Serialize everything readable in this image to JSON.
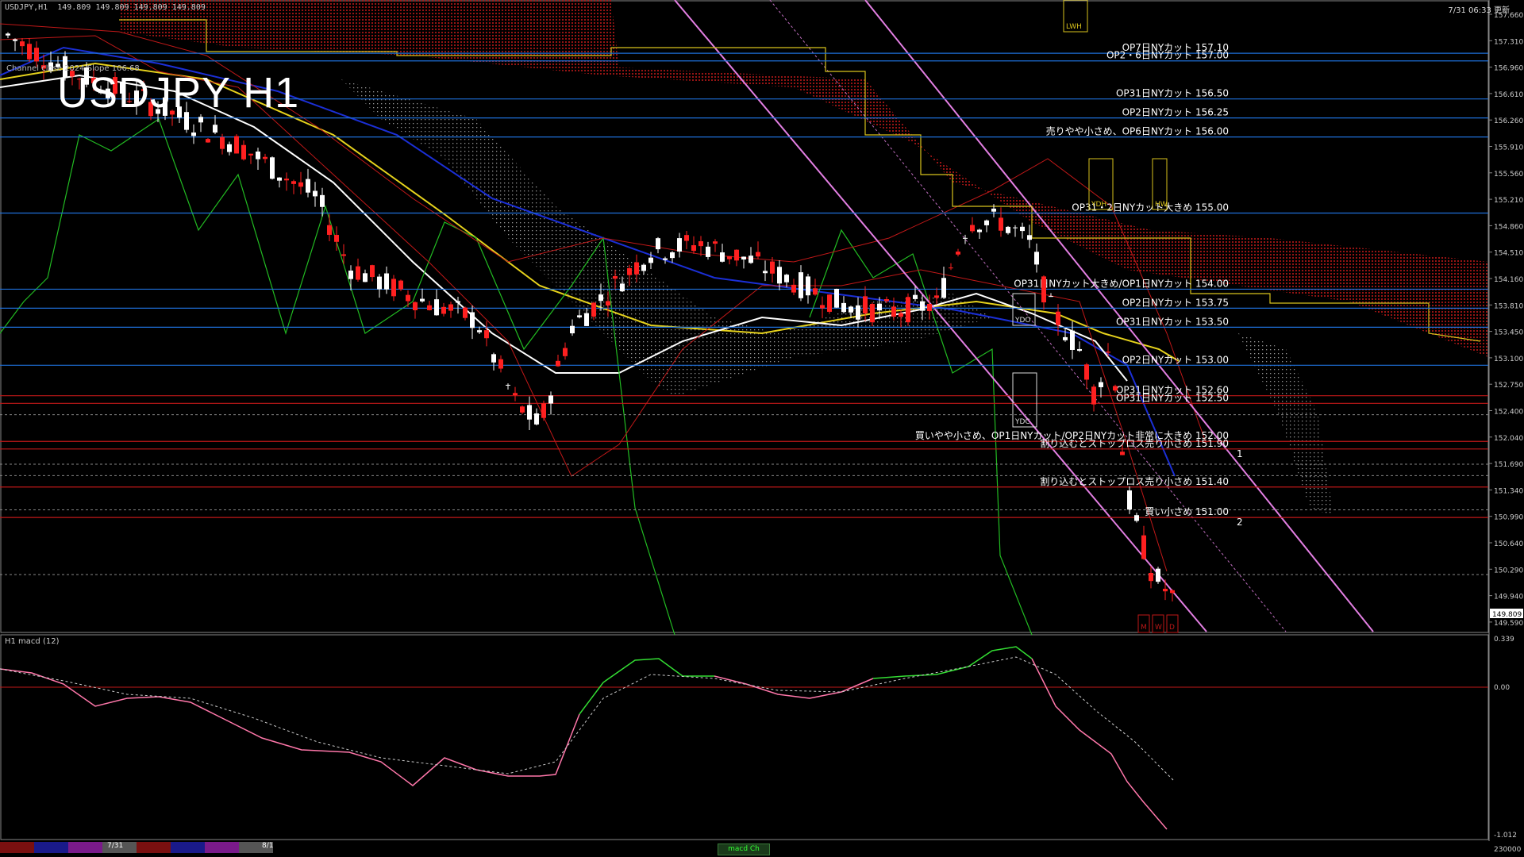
{
  "window": {
    "symbol_header": "USDJPY,H1  149.809 149.809 149.809 149.809",
    "title_overlay": "USDJPY H1",
    "channel_label": "Channel close 2024 Slope 106.68",
    "datetime": "7/31 06:33 更新",
    "macd_label": "H1 macd (12)",
    "tab_label": "macd Ch"
  },
  "colors": {
    "background": "#000000",
    "bull_candle": "#ffffff",
    "bear_candle": "#ff2020",
    "blue_level": "#1e6fd9",
    "red_level": "#c01818",
    "cloud_fill": "#8a1010",
    "macd_up": "#33dd33",
    "macd_down": "#ff77aa",
    "signal": "#cccccc"
  },
  "price_axis": {
    "ticks": [
      "157.660",
      "157.310",
      "156.960",
      "156.610",
      "156.260",
      "155.910",
      "155.560",
      "155.210",
      "154.860",
      "154.510",
      "154.160",
      "153.810",
      "153.450",
      "153.100",
      "152.750",
      "152.400",
      "152.040",
      "151.690",
      "151.340",
      "150.990",
      "150.640",
      "150.290",
      "149.940",
      "149.590"
    ],
    "current": "149.809"
  },
  "macd_axis": {
    "ticks": [
      "0.339",
      "0.00",
      "-1.012"
    ],
    "bottom": "230000"
  },
  "levels": [
    {
      "price": 157.1,
      "text": "OP7日NYカット 157.10",
      "kind": "blue"
    },
    {
      "price": 157.0,
      "text": "OP2・6日NYカット 157.00",
      "kind": "blue"
    },
    {
      "price": 156.5,
      "text": "OP31日NYカット 156.50",
      "kind": "blue"
    },
    {
      "price": 156.25,
      "text": "OP2日NYカット 156.25",
      "kind": "blue"
    },
    {
      "price": 156.0,
      "text": "売りやや小さめ、OP6日NYカット 156.00",
      "kind": "blue"
    },
    {
      "price": 155.0,
      "text": "OP31・2日NYカット大きめ 155.00",
      "kind": "blue"
    },
    {
      "price": 154.0,
      "text": "OP31日NYカット大きめ/OP1日NYカット 154.00",
      "kind": "blue"
    },
    {
      "price": 153.75,
      "text": "OP2日NYカット 153.75",
      "kind": "blue"
    },
    {
      "price": 153.5,
      "text": "OP31日NYカット 153.50",
      "kind": "blue"
    },
    {
      "price": 153.0,
      "text": "OP2日NYカット 153.00",
      "kind": "blue"
    },
    {
      "price": 152.6,
      "text": "OP31日NYカット 152.60",
      "kind": "red"
    },
    {
      "price": 152.5,
      "text": "OP31日NYカット 152.50",
      "kind": "red"
    },
    {
      "price": 152.0,
      "text": "買いやや小さめ、OP1日NYカット/OP2日NYカット非常に大きめ 152.00",
      "kind": "red"
    },
    {
      "price": 151.9,
      "text": "割り込むとストップロス売り小さめ 151.90",
      "kind": "red",
      "mark": "1"
    },
    {
      "price": 151.4,
      "text": "割り込むとストップロス売り小さめ 151.40",
      "kind": "red"
    },
    {
      "price": 151.0,
      "text": "買い小さめ 151.00",
      "kind": "red",
      "mark": "2"
    }
  ],
  "boxes": {
    "lwh": "LWH",
    "ydh": "YDH",
    "hw": "HW",
    "ydo": "YDO",
    "ydc": "YDC",
    "m": "M",
    "w": "W",
    "d": "D"
  },
  "date_labels": [
    "7/31",
    "8/1"
  ]
}
